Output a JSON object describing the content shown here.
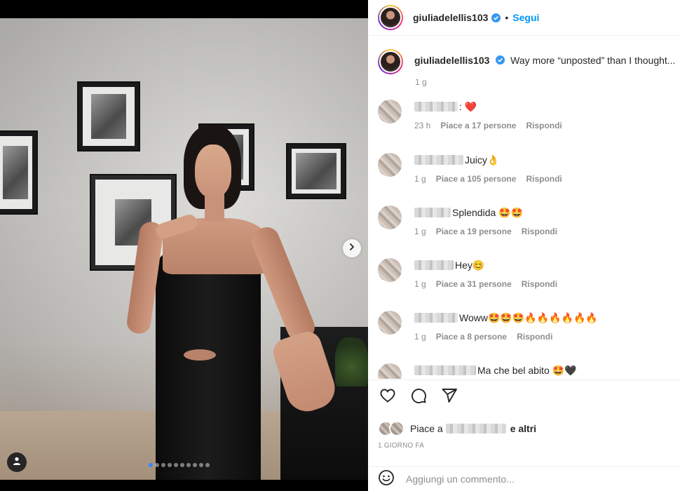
{
  "post": {
    "username": "giuliadelellis103",
    "follow_label": "Segui",
    "separator": "•",
    "caption": "Way more “unposted” than I thought...",
    "caption_time": "1 g"
  },
  "media": {
    "carousel_dots": 10,
    "active_dot": 0,
    "next_icon": "chevron-right-icon",
    "tag_icon": "user-tag-icon"
  },
  "comments": [
    {
      "emoji_text": ": ❤️",
      "time": "23 h",
      "likes": "Piace a 17 persone",
      "reply": "Rispondi"
    },
    {
      "emoji_text": "Juicy👌",
      "time": "1 g",
      "likes": "Piace a 105 persone",
      "reply": "Rispondi"
    },
    {
      "emoji_text": "Splendida 🤩🤩",
      "time": "1 g",
      "likes": "Piace a 19 persone",
      "reply": "Rispondi"
    },
    {
      "emoji_text": "Hey😊",
      "time": "1 g",
      "likes": "Piace a 31 persone",
      "reply": "Rispondi"
    },
    {
      "emoji_text": "Woww🤩🤩🤩🔥🔥🔥🔥🔥🔥",
      "time": "1 g",
      "likes": "Piace a 8 persone",
      "reply": "Rispondi"
    },
    {
      "emoji_text": "Ma che bel abito 🤩🖤",
      "time": "",
      "likes": "",
      "reply": ""
    }
  ],
  "actions": {
    "like_icon": "heart-icon",
    "comment_icon": "comment-icon",
    "share_icon": "share-icon"
  },
  "likes_line": {
    "prefix": "Piace a",
    "suffix": "e altri"
  },
  "post_time": "1 GIORNO FA",
  "add_comment": {
    "placeholder": "Aggiungi un commento...",
    "emoji_icon": "emoji-icon"
  },
  "colors": {
    "accent": "#0095f6",
    "verified": "#3897f0",
    "muted": "#8e8e8e",
    "text": "#262626"
  }
}
